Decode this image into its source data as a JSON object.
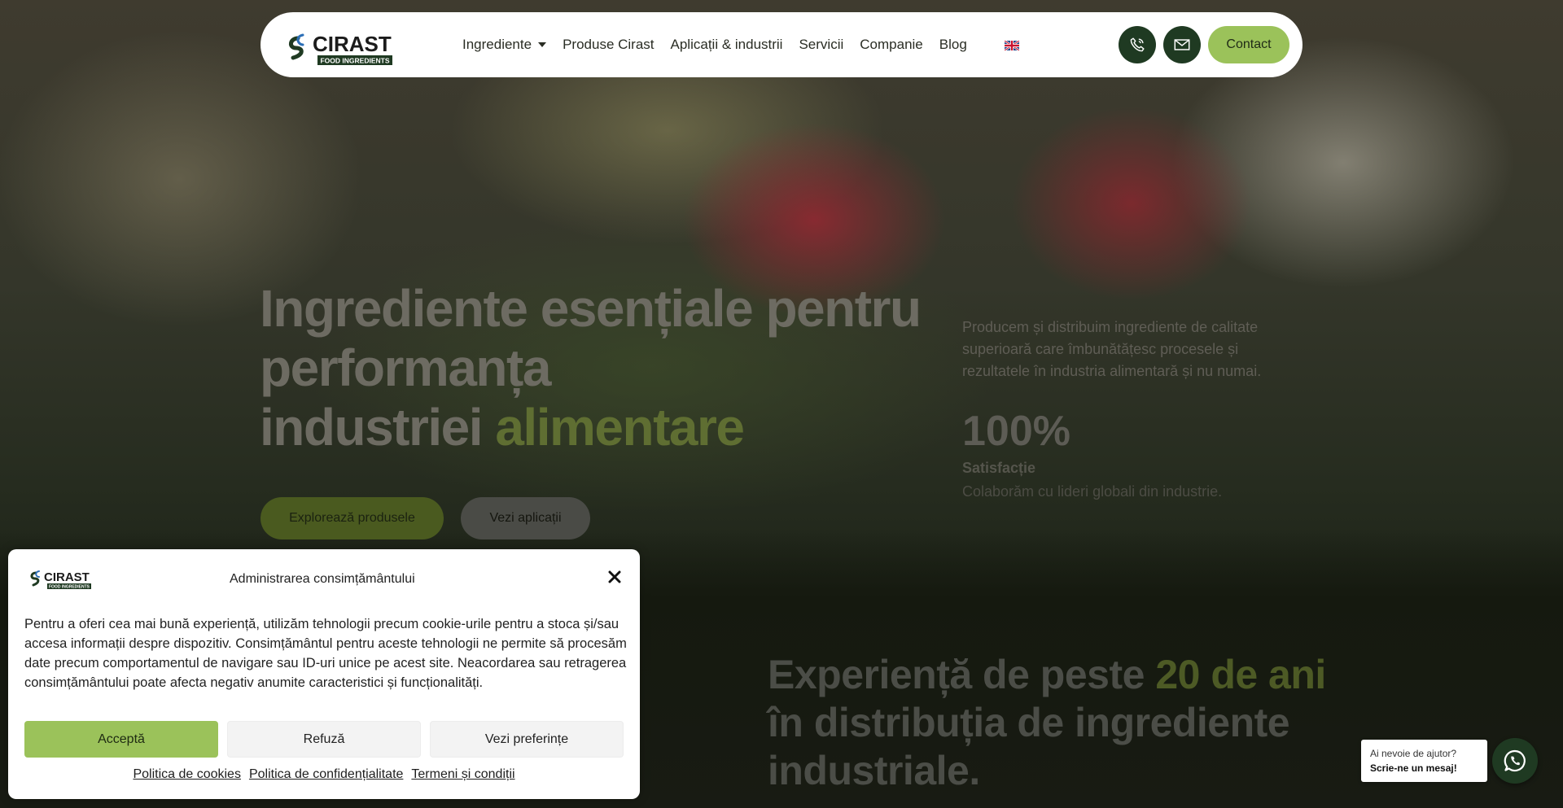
{
  "brand": {
    "name": "CIRAST",
    "tagline": "FOOD INGREDIENTS"
  },
  "nav": {
    "items": [
      {
        "label": "Ingrediente",
        "has_dropdown": true
      },
      {
        "label": "Produse Cirast"
      },
      {
        "label": "Aplicații & industrii"
      },
      {
        "label": "Servicii"
      },
      {
        "label": "Companie"
      },
      {
        "label": "Blog"
      }
    ],
    "language_icon": "uk-flag-icon",
    "phone_icon": "phone-icon",
    "mail_icon": "mail-icon",
    "contact_label": "Contact"
  },
  "hero": {
    "title_line1": "Ingrediente esențiale pentru",
    "title_line2": "performanța",
    "title_line3_plain": "industriei ",
    "title_line3_accent": "alimentare",
    "description": "Producem și distribuim ingrediente de calitate superioară care îmbunătățesc procesele și rezultatele în industria alimentară și nu numai.",
    "primary_button": "Explorează produsele",
    "secondary_button": "Vezi aplicații",
    "stat_value": "100%",
    "stat_label": "Satisfacție",
    "stat_caption": "Colaborăm cu lideri globali din industrie."
  },
  "experience": {
    "title_plain1": "Experiență de peste ",
    "title_accent": "20 de ani",
    "title_plain2": "în distribuția de ingrediente industriale."
  },
  "cookie_modal": {
    "title": "Administrarea consimțământului",
    "body": "Pentru a oferi cea mai bună experiență, utilizăm tehnologii precum cookie-urile pentru a stoca și/sau accesa informații despre dispozitiv. Consimțământul pentru aceste tehnologii ne permite să procesăm date precum comportamentul de navigare sau ID-uri unice pe acest site. Neacordarea sau retragerea consimțământului poate afecta negativ anumite caracteristici și funcționalități.",
    "accept": "Acceptă",
    "refuse": "Refuză",
    "preferences": "Vezi preferințe",
    "links": [
      "Politica de cookies",
      "Politica de confidențialitate",
      "Termeni și condiții"
    ]
  },
  "whatsapp": {
    "line1": "Ai nevoie de ajutor?",
    "line2": "Scrie-ne un mesaj!",
    "icon": "whatsapp-icon"
  },
  "colors": {
    "accent_green": "#9bc25a",
    "dark_green": "#1f3a22"
  }
}
